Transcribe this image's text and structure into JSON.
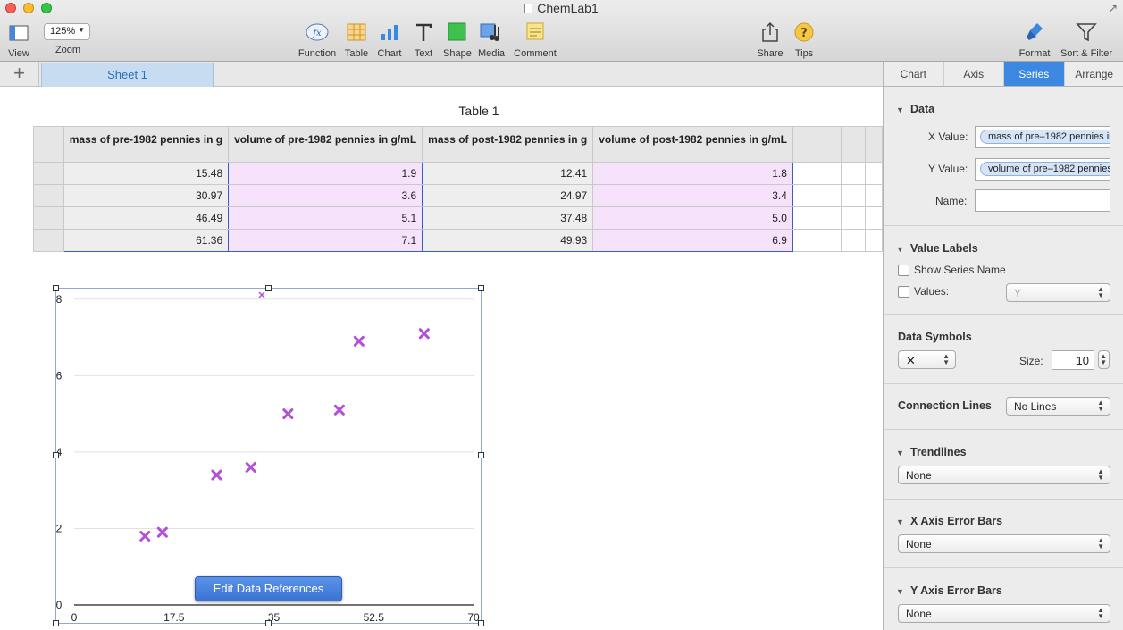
{
  "window": {
    "title": "ChemLab1",
    "colors": {
      "close": "#fc5f57",
      "minimize": "#fdbc2e",
      "zoom": "#33c748"
    }
  },
  "toolbar": {
    "view": "View",
    "zoom_value": "125%",
    "zoom": "Zoom",
    "function": "Function",
    "table": "Table",
    "chart": "Chart",
    "text": "Text",
    "shape": "Shape",
    "media": "Media",
    "comment": "Comment",
    "share": "Share",
    "tips": "Tips",
    "format": "Format",
    "sort_filter": "Sort & Filter"
  },
  "sheets": {
    "tabs": [
      {
        "label": "Sheet 1"
      }
    ]
  },
  "table": {
    "title": "Table 1",
    "headers": [
      "mass of pre-1982 pennies in g",
      "volume of pre-1982 pennies in g/mL",
      "mass of post-1982 pennies in g",
      "volume of post-1982 pennies in g/mL"
    ],
    "rows": [
      [
        "15.48",
        "1.9",
        "12.41",
        "1.8"
      ],
      [
        "30.97",
        "3.6",
        "24.97",
        "3.4"
      ],
      [
        "46.49",
        "5.1",
        "37.48",
        "5.0"
      ],
      [
        "61.36",
        "7.1",
        "49.93",
        "6.9"
      ]
    ]
  },
  "chart_data": {
    "type": "scatter",
    "marker_color": "#b44fd8",
    "xlim": [
      0,
      70
    ],
    "ylim": [
      0,
      9
    ],
    "x_ticks": [
      "0",
      "17.5",
      "35",
      "52.5",
      "70"
    ],
    "y_ticks": [
      "0",
      "2",
      "4",
      "6",
      "8"
    ],
    "grid": true,
    "series": [
      {
        "x": [
          15.48,
          30.97,
          46.49,
          61.36
        ],
        "y": [
          1.9,
          3.6,
          5.1,
          7.1
        ]
      },
      {
        "x": [
          12.41,
          24.97,
          37.48,
          49.93
        ],
        "y": [
          1.8,
          3.4,
          5.0,
          6.9
        ]
      }
    ]
  },
  "edit_data_references": "Edit Data References",
  "inspector": {
    "tabs": [
      "Chart",
      "Axis",
      "Series",
      "Arrange"
    ],
    "active_tab": "Series",
    "data": {
      "title": "Data",
      "x_label": "X Value:",
      "x_value": "mass of pre–1982 pennies in g",
      "y_label": "Y Value:",
      "y_value": "volume of pre–1982 pennies in g/mL",
      "name_label": "Name:",
      "name_value": ""
    },
    "value_labels": {
      "title": "Value Labels",
      "show_series_name": "Show Series Name",
      "values": "Values:",
      "values_select": "Y"
    },
    "data_symbols": {
      "title": "Data Symbols",
      "symbol": "✕",
      "size_label": "Size:",
      "size_value": "10"
    },
    "connection_lines": {
      "title": "Connection Lines",
      "value": "No Lines"
    },
    "trendlines": {
      "title": "Trendlines",
      "value": "None"
    },
    "x_error_bars": {
      "title": "X Axis Error Bars",
      "value": "None"
    },
    "y_error_bars": {
      "title": "Y Axis Error Bars",
      "value": "None"
    }
  }
}
